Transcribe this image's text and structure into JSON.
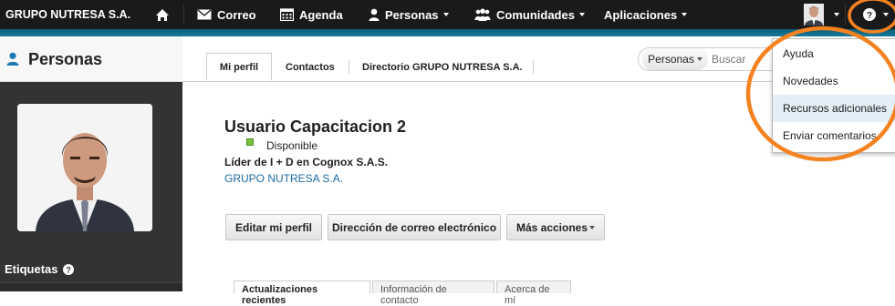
{
  "topbar": {
    "brand": "GRUPO NUTRESA S.A.",
    "items": [
      {
        "label": "Correo",
        "icon": "mail-icon"
      },
      {
        "label": "Agenda",
        "icon": "calendar-icon"
      },
      {
        "label": "Personas",
        "icon": "person-icon"
      },
      {
        "label": "Comunidades",
        "icon": "community-icon"
      },
      {
        "label": "Aplicaciones"
      }
    ]
  },
  "sidebar": {
    "title": "Personas",
    "tags_label": "Etiquetas"
  },
  "tabs": [
    "Mi perfil",
    "Contactos",
    "Directorio GRUPO NUTRESA S.A."
  ],
  "search": {
    "scope": "Personas",
    "placeholder": "Buscar"
  },
  "profile": {
    "name": "Usuario Capacitacion 2",
    "status": "Disponible",
    "job": "Líder de I + D en Cognox S.A.S.",
    "org": "GRUPO NUTRESA S.A."
  },
  "actions": {
    "edit": "Editar mi perfil",
    "email": "Dirección de correo electrónico",
    "more": "Más acciones"
  },
  "bottom_tabs": [
    "Actualizaciones recientes",
    "Información de contacto",
    "Acerca de mí"
  ],
  "help_menu": {
    "items": [
      "Ayuda",
      "Novedades",
      "Recursos adicionales",
      "Enviar comentarios"
    ],
    "highlighted_index": 2
  },
  "colors": {
    "topbar": "#1a1a1a",
    "accent_strip": "#0b5c78",
    "link": "#1a6ba3",
    "status_green": "#7ac142",
    "annotation_orange": "#f58220"
  }
}
